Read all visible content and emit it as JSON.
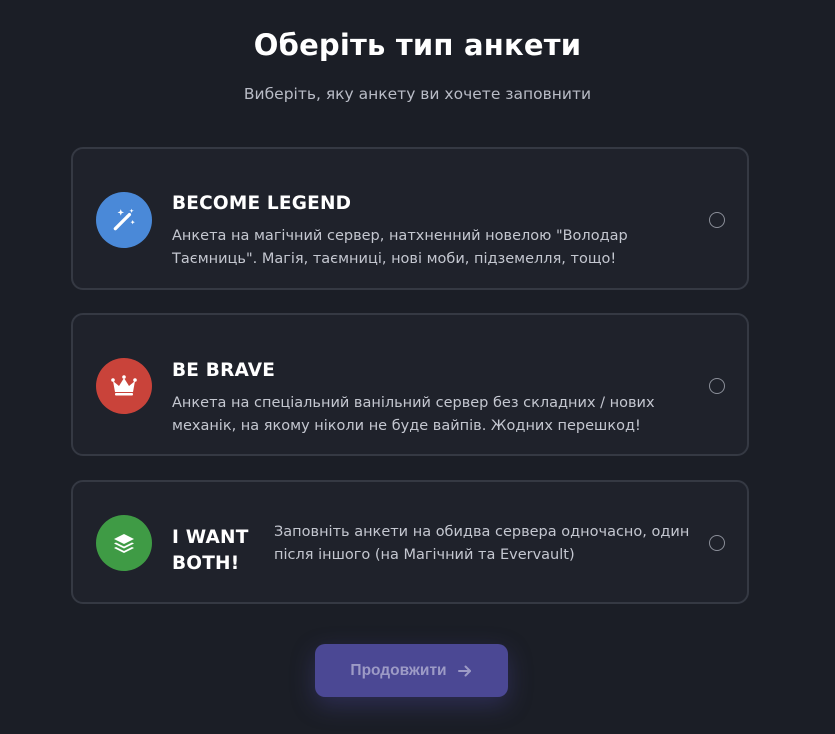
{
  "header": {
    "title": "Оберіть тип анкети",
    "subtitle": "Виберіть, яку анкету ви хочете заповнити"
  },
  "options": [
    {
      "name": "BECOME LEGEND",
      "description": "Анкета на магічний сервер, натхненний новелою \"Володар Таємниць\". Магія, таємниці, нові моби, підземелля, тощо!",
      "icon": "magic-wand-icon",
      "color": "#4a89d8",
      "selected": false
    },
    {
      "name": "BE BRAVE",
      "description": "Анкета на спеціальний ванільний сервер без складних / нових механік, на якому ніколи не буде вайпів. Жодних перешкод!",
      "icon": "crown-icon",
      "color": "#c9433a",
      "selected": false
    },
    {
      "name": "I WANT BOTH!",
      "description": "Заповніть анкети на обидва сервера одночасно, один після іншого (на Магічний та Evervault)",
      "icon": "layers-icon",
      "color": "#3f9b45",
      "selected": false
    }
  ],
  "footer": {
    "continue_label": "Продовжити",
    "continue_icon": "arrow-right-icon",
    "continue_enabled": false
  }
}
